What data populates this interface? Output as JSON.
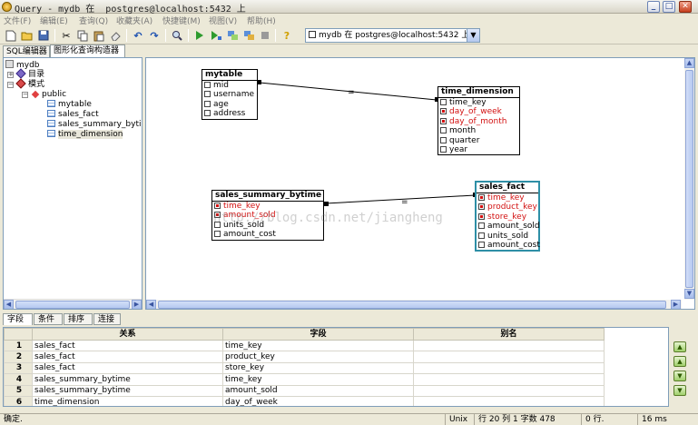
{
  "window": {
    "title": "Query - mydb 在  postgres@localhost:5432 上 "
  },
  "menu": [
    "文件(F)",
    "编辑(E)",
    "查询(Q)",
    "收藏夹(A)",
    "快捷键(M)",
    "视图(V)",
    "帮助(H)"
  ],
  "toolbar": {
    "connection": "mydb 在  postgres@localhost:5432 上"
  },
  "tabs": {
    "sql_editor": "SQL编辑器",
    "graphical_builder": "图形化查询构造器"
  },
  "tree": {
    "root": "mydb",
    "catalog": "目录",
    "schema": "模式",
    "public": "public",
    "tables": [
      "mytable",
      "sales_fact",
      "sales_summary_bytime",
      "time_dimension"
    ]
  },
  "canvas": {
    "join_label_1": "=",
    "join_label_2": "=",
    "watermark": "http://blog.csdn.net/jiangheng",
    "tables": {
      "mytable": {
        "name": "mytable",
        "cols": [
          {
            "name": "mid",
            "sel": false
          },
          {
            "name": "username",
            "sel": false
          },
          {
            "name": "age",
            "sel": false
          },
          {
            "name": "address",
            "sel": false
          }
        ]
      },
      "time_dimension": {
        "name": "time_dimension",
        "cols": [
          {
            "name": "time_key",
            "sel": false
          },
          {
            "name": "day_of_week",
            "sel": true
          },
          {
            "name": "day_of_month",
            "sel": true
          },
          {
            "name": "month",
            "sel": false
          },
          {
            "name": "quarter",
            "sel": false
          },
          {
            "name": "year",
            "sel": false
          }
        ]
      },
      "sales_summary_bytime": {
        "name": "sales_summary_bytime",
        "cols": [
          {
            "name": "time_key",
            "sel": true
          },
          {
            "name": "amount_sold",
            "sel": true
          },
          {
            "name": "units_sold",
            "sel": false
          },
          {
            "name": "amount_cost",
            "sel": false
          }
        ]
      },
      "sales_fact": {
        "name": "sales_fact",
        "cols": [
          {
            "name": "time_key",
            "sel": true
          },
          {
            "name": "product_key",
            "sel": true
          },
          {
            "name": "store_key",
            "sel": true
          },
          {
            "name": "amount_sold",
            "sel": false
          },
          {
            "name": "units_sold",
            "sel": false
          },
          {
            "name": "amount_cost",
            "sel": false
          }
        ]
      }
    }
  },
  "bottom_tabs": [
    "字段",
    "条件",
    "排序",
    "连接"
  ],
  "grid": {
    "headers": [
      "关系",
      "字段",
      "别名"
    ],
    "rows": [
      {
        "n": "1",
        "rel": "sales_fact",
        "field": "time_key",
        "alias": ""
      },
      {
        "n": "2",
        "rel": "sales_fact",
        "field": "product_key",
        "alias": ""
      },
      {
        "n": "3",
        "rel": "sales_fact",
        "field": "store_key",
        "alias": ""
      },
      {
        "n": "4",
        "rel": "sales_summary_bytime",
        "field": "time_key",
        "alias": ""
      },
      {
        "n": "5",
        "rel": "sales_summary_bytime",
        "field": "amount_sold",
        "alias": ""
      },
      {
        "n": "6",
        "rel": "time_dimension",
        "field": "day_of_week",
        "alias": ""
      }
    ]
  },
  "status": {
    "left": "确定.",
    "encoding": "Unix",
    "position": "行 20 列 1 字数 478",
    "rows": "0 行.",
    "time": "16 ms"
  }
}
